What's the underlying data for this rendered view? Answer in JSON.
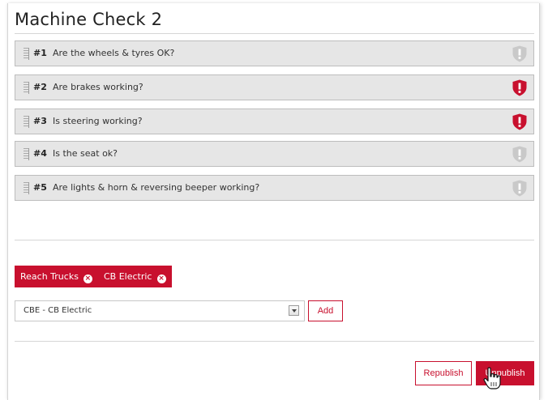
{
  "checklist": {
    "title": "Machine Check 2",
    "questions": [
      {
        "number": "#1",
        "text": "Are the wheels & tyres OK?",
        "critical": false
      },
      {
        "number": "#2",
        "text": "Are brakes working?",
        "critical": true
      },
      {
        "number": "#3",
        "text": "Is steering working?",
        "critical": true
      },
      {
        "number": "#4",
        "text": "Is the seat ok?",
        "critical": false
      },
      {
        "number": "#5",
        "text": "Are lights & horn & reversing beeper working?",
        "critical": false
      }
    ]
  },
  "tags": [
    {
      "label": "Reach Trucks"
    },
    {
      "label": "CB Electric"
    }
  ],
  "machine_select": {
    "value": "CBE - CB Electric"
  },
  "actions": {
    "add_label": "Add",
    "republish_label": "Republish",
    "unpublish_label": "Unpublish"
  },
  "colors": {
    "accent": "#c8102e",
    "shield_critical": "#c8102e",
    "shield_normal": "#c9c9c9",
    "row_bg": "#e6e6e6"
  },
  "icons": {
    "tag_remove": "x-circle",
    "question_status": "shield-exclamation",
    "row_handle": "drag-grip",
    "pointer": "hand-cursor"
  }
}
